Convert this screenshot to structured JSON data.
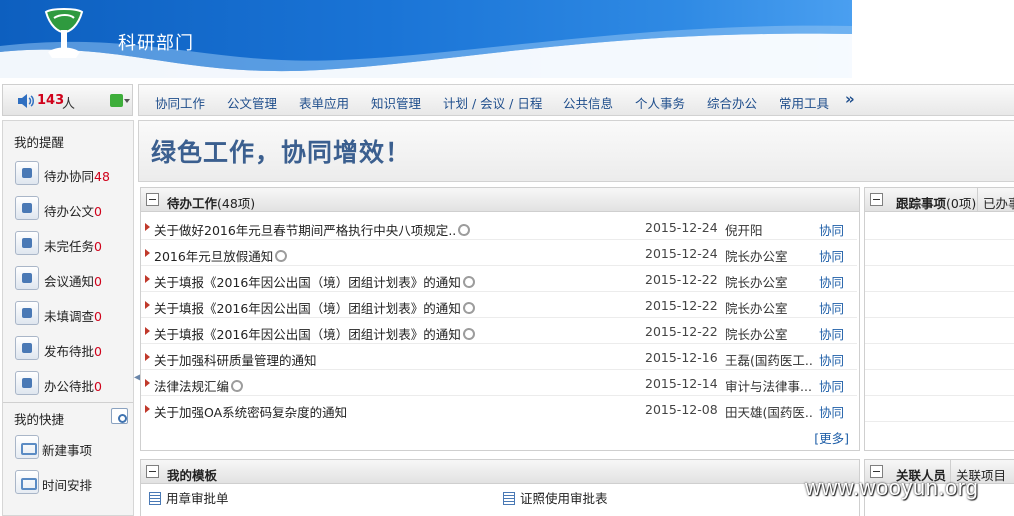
{
  "header": {
    "title": "科研部门"
  },
  "topbar": {
    "online_count": "143",
    "online_unit": "人"
  },
  "menu": {
    "items": [
      "协同工作",
      "公文管理",
      "表单应用",
      "知识管理",
      "计划 / 会议 / 日程",
      "公共信息",
      "个人事务",
      "综合办公",
      "常用工具"
    ],
    "more": "»"
  },
  "sidebar": {
    "reminders_title": "我的提醒",
    "reminders": [
      {
        "label": "待办协同",
        "count": "48",
        "icon": "collaboration-icon"
      },
      {
        "label": "待办公文",
        "count": "0",
        "icon": "document-icon"
      },
      {
        "label": "未完任务",
        "count": "0",
        "icon": "task-icon"
      },
      {
        "label": "会议通知",
        "count": "0",
        "icon": "meeting-icon"
      },
      {
        "label": "未填调查",
        "count": "0",
        "icon": "survey-icon"
      },
      {
        "label": "发布待批",
        "count": "0",
        "icon": "chart-icon"
      },
      {
        "label": "办公待批",
        "count": "0",
        "icon": "office-icon"
      }
    ],
    "quick_title": "我的快捷",
    "quick_items": [
      {
        "label": "新建事项",
        "icon": "new-item-icon"
      },
      {
        "label": "时间安排",
        "icon": "calendar-icon"
      }
    ]
  },
  "slogan": "绿色工作，协同增效！",
  "pending": {
    "title": "待办工作",
    "count": "(48项)",
    "more": "[更多]",
    "rows": [
      {
        "title": "关于做好2016年元旦春节期间严格执行中央八项规定..",
        "attachment": true,
        "date": "2015-12-24",
        "from": "倪开阳",
        "type": "协同"
      },
      {
        "title": "2016年元旦放假通知",
        "attachment": true,
        "date": "2015-12-24",
        "from": "院长办公室",
        "type": "协同"
      },
      {
        "title": "关于填报《2016年因公出国（境）团组计划表》的通知",
        "attachment": true,
        "date": "2015-12-22",
        "from": "院长办公室",
        "type": "协同"
      },
      {
        "title": "关于填报《2016年因公出国（境）团组计划表》的通知",
        "attachment": true,
        "date": "2015-12-22",
        "from": "院长办公室",
        "type": "协同"
      },
      {
        "title": "关于填报《2016年因公出国（境）团组计划表》的通知",
        "attachment": true,
        "date": "2015-12-22",
        "from": "院长办公室",
        "type": "协同"
      },
      {
        "title": "关于加强科研质量管理的通知",
        "attachment": false,
        "date": "2015-12-16",
        "from": "王磊(国药医工...",
        "type": "协同"
      },
      {
        "title": "法律法规汇编",
        "attachment": true,
        "date": "2015-12-14",
        "from": "审计与法律事...",
        "type": "协同"
      },
      {
        "title": "关于加强OA系统密码复杂度的通知",
        "attachment": false,
        "date": "2015-12-08",
        "from": "田天雄(国药医...",
        "type": "协同"
      }
    ]
  },
  "tracking": {
    "tab_active": "跟踪事项",
    "count": "(0项)",
    "tab_other": "已办事"
  },
  "templates": {
    "title": "我的模板",
    "items": [
      "用章审批单",
      "证照使用审批表"
    ]
  },
  "related": {
    "tab_active": "关联人员",
    "tab_other": "关联项目"
  },
  "watermark": "www.wooyun.org"
}
